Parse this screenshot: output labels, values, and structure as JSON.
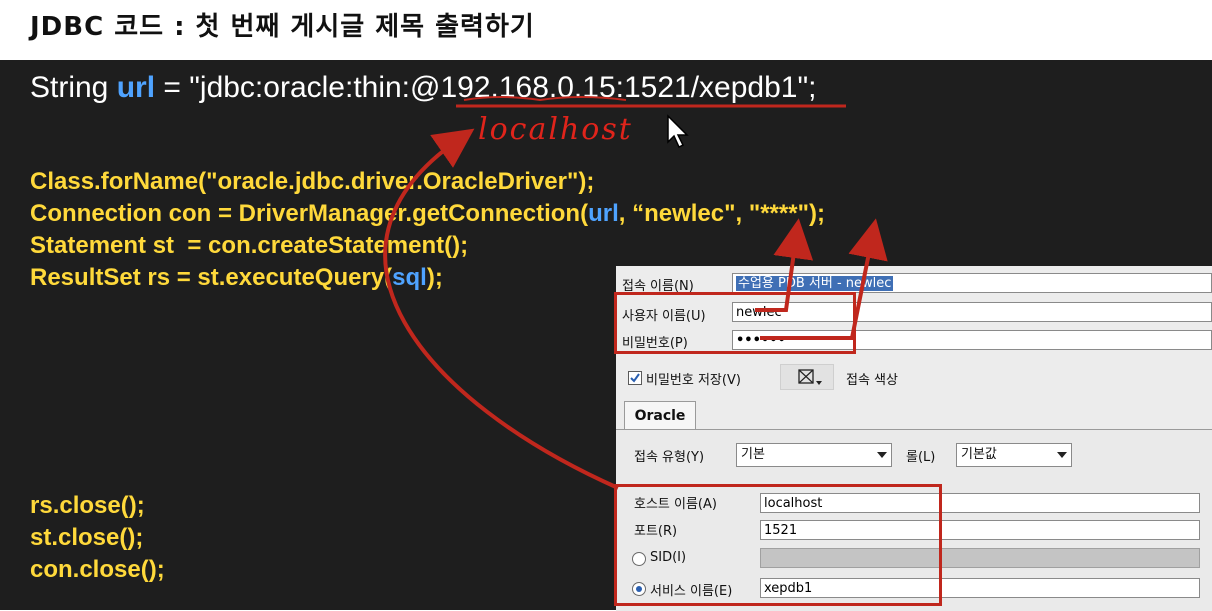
{
  "slide": {
    "title": "JDBC 코드 : 첫 번째 게시글 제목 출력하기"
  },
  "code": {
    "url_line": {
      "prefix": "String ",
      "keyword": "url",
      "rest": " = \"jdbc:oracle:thin:@192.168.0.15:1521/xepdb1\";"
    },
    "line_class": "Class.forName(\"oracle.jdbc.driver.OracleDriver\");",
    "line_connection": {
      "a": "Connection con = DriverManager.getConnection(",
      "url": "url",
      "b": ", “newlec\", \"****\");"
    },
    "line_statement": "Statement st  = con.createStatement();",
    "line_resultset": {
      "a": "ResultSet rs = st.executeQuery(",
      "sql": "sql",
      "b": ");"
    },
    "line_rs_close": "rs.close();",
    "line_st_close": "st.close();",
    "line_con_close": "con.close();"
  },
  "annotation": {
    "handwritten": "localhost",
    "pen_color": "#e0241b"
  },
  "dialog": {
    "connection_name_label": "접속 이름(N)",
    "connection_name_value": "수업용 PDB 서버 - newlec",
    "username_label": "사용자 이름(U)",
    "username_value": "newlec",
    "password_label": "비밀번호(P)",
    "password_value": "••••••",
    "save_password_label": "비밀번호 저장(V)",
    "connection_color_label": "접속 색상",
    "tab_label": "Oracle",
    "connection_type_label": "접속 유형(Y)",
    "connection_type_value": "기본",
    "role_label": "롤(L)",
    "role_value": "기본값",
    "hostname_label": "호스트 이름(A)",
    "hostname_value": "localhost",
    "port_label": "포트(R)",
    "port_value": "1521",
    "sid_label": "SID(I)",
    "service_name_label": "서비스 이름(E)",
    "service_name_value": "xepdb1"
  }
}
